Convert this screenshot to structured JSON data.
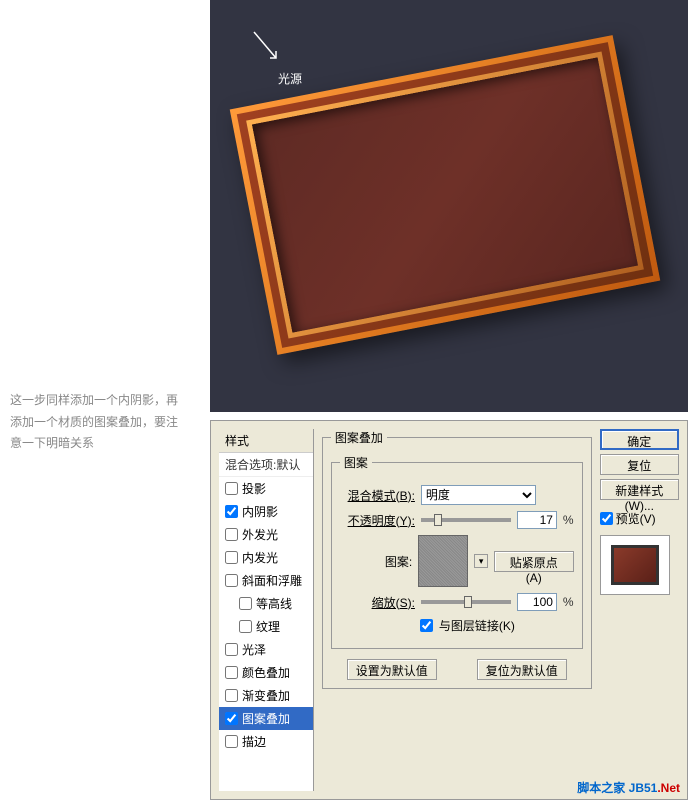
{
  "description": "这一步同样添加一个内阴影，再添加一个材质的图案叠加，要注意一下明暗关系",
  "canvas": {
    "light_label": "光源"
  },
  "dialog": {
    "styles_header": "样式",
    "blend_options": "混合选项:默认",
    "style_items": [
      {
        "label": "投影",
        "checked": false,
        "active": false
      },
      {
        "label": "内阴影",
        "checked": true,
        "active": false
      },
      {
        "label": "外发光",
        "checked": false,
        "active": false
      },
      {
        "label": "内发光",
        "checked": false,
        "active": false
      },
      {
        "label": "斜面和浮雕",
        "checked": false,
        "active": false
      },
      {
        "label": "等高线",
        "checked": false,
        "active": false,
        "indent": true
      },
      {
        "label": "纹理",
        "checked": false,
        "active": false,
        "indent": true
      },
      {
        "label": "光泽",
        "checked": false,
        "active": false
      },
      {
        "label": "颜色叠加",
        "checked": false,
        "active": false
      },
      {
        "label": "渐变叠加",
        "checked": false,
        "active": false
      },
      {
        "label": "图案叠加",
        "checked": true,
        "active": true
      },
      {
        "label": "描边",
        "checked": false,
        "active": false
      }
    ],
    "panel_title": "图案叠加",
    "pattern_group": "图案",
    "blend_mode_label": "混合模式(B):",
    "blend_mode_value": "明度",
    "opacity_label": "不透明度(Y):",
    "opacity_value": "17",
    "pattern_label": "图案:",
    "snap_origin": "贴紧原点(A)",
    "scale_label": "缩放(S):",
    "scale_value": "100",
    "percent": "%",
    "link_layer": "与图层链接(K)",
    "set_default": "设置为默认值",
    "reset_default": "复位为默认值",
    "ok": "确定",
    "cancel": "复位",
    "new_style": "新建样式(W)...",
    "preview": "预览(V)"
  },
  "watermark": {
    "part1": "脚本之家 ",
    "part2": "JB51",
    "part3": ".Net"
  }
}
